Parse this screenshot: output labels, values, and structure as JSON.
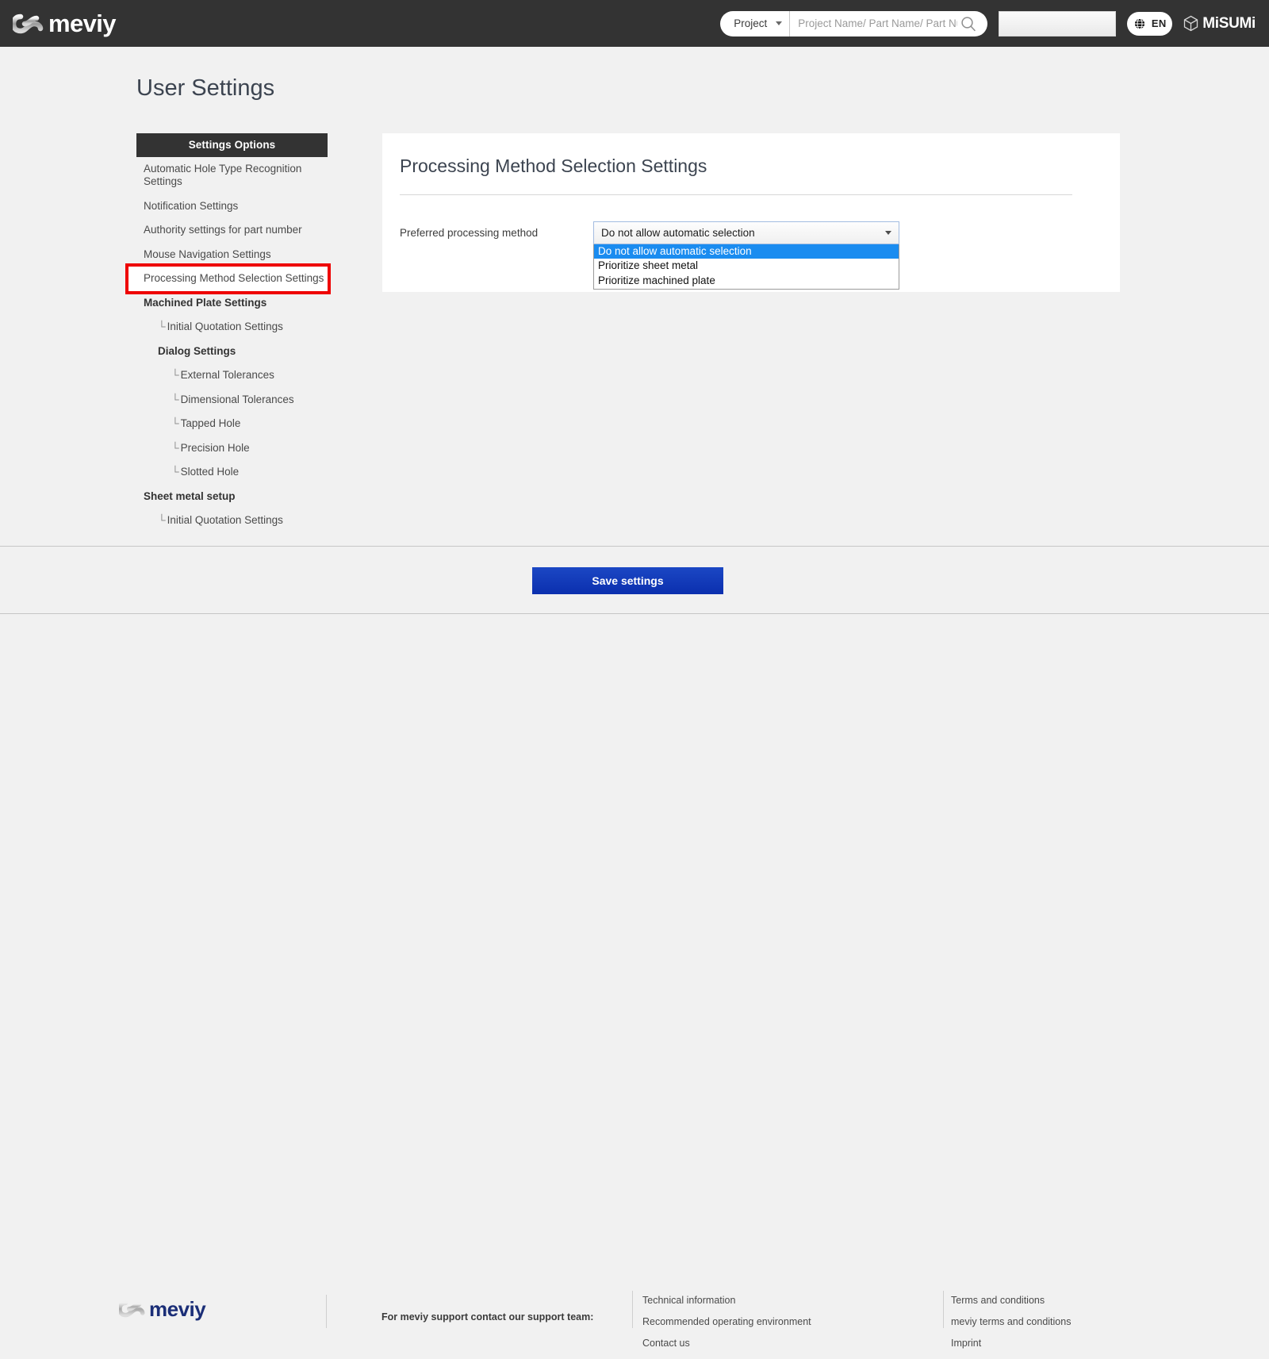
{
  "header": {
    "brand": "meviy",
    "search": {
      "scope_label": "Project",
      "placeholder": "Project Name/ Part Name/ Part Number",
      "value": "",
      "icon": "search-icon"
    },
    "language": {
      "code": "EN",
      "icon": "globe-icon"
    },
    "corporate_brand": "MiSUMi"
  },
  "page": {
    "title": "User Settings"
  },
  "sidebar": {
    "header": "Settings Options",
    "items": [
      {
        "label": "Automatic Hole Type Recognition Settings",
        "type": "link",
        "highlighted": false
      },
      {
        "label": "Notification Settings",
        "type": "link",
        "highlighted": false
      },
      {
        "label": "Authority settings for part number",
        "type": "link",
        "highlighted": false
      },
      {
        "label": "Mouse Navigation Settings",
        "type": "link",
        "highlighted": false
      },
      {
        "label": "Processing Method Selection Settings",
        "type": "link",
        "highlighted": true
      },
      {
        "label": "Machined Plate Settings",
        "type": "group",
        "highlighted": false
      },
      {
        "label": "Initial Quotation Settings",
        "type": "sub",
        "highlighted": false
      },
      {
        "label": "Dialog Settings",
        "type": "group-indent",
        "highlighted": false
      },
      {
        "label": "External Tolerances",
        "type": "sub2",
        "highlighted": false
      },
      {
        "label": "Dimensional Tolerances",
        "type": "sub2",
        "highlighted": false
      },
      {
        "label": "Tapped Hole",
        "type": "sub2",
        "highlighted": false
      },
      {
        "label": "Precision Hole",
        "type": "sub2",
        "highlighted": false
      },
      {
        "label": "Slotted Hole",
        "type": "sub2",
        "highlighted": false
      },
      {
        "label": "Sheet metal setup",
        "type": "group",
        "highlighted": false
      },
      {
        "label": "Initial Quotation Settings",
        "type": "sub",
        "highlighted": false
      }
    ],
    "tee_glyph": "└"
  },
  "main": {
    "card_title": "Processing Method Selection Settings",
    "field_label": "Preferred processing method",
    "select": {
      "value": "Do not allow automatic selection",
      "expanded": true,
      "options": [
        "Do not allow automatic selection",
        "Prioritize sheet metal",
        "Prioritize machined plate"
      ],
      "selected_index": 0
    }
  },
  "actions": {
    "save_label": "Save settings"
  },
  "footer": {
    "brand": "meviy",
    "support_heading": "For meviy support contact our support team:",
    "support_link": "",
    "columns": [
      {
        "links": [
          "Technical information",
          "Recommended operating environment",
          "Contact us"
        ]
      },
      {
        "links": [
          "Terms and conditions",
          "meviy terms and conditions",
          "Imprint"
        ]
      }
    ]
  },
  "colors": {
    "header_bg": "#333333",
    "page_bg": "#f1f1f1",
    "highlight_outline": "#ee0000",
    "option_selected_bg": "#1a8cf0",
    "save_button": "#0b2fae",
    "footer_brand": "#1b2e77"
  }
}
